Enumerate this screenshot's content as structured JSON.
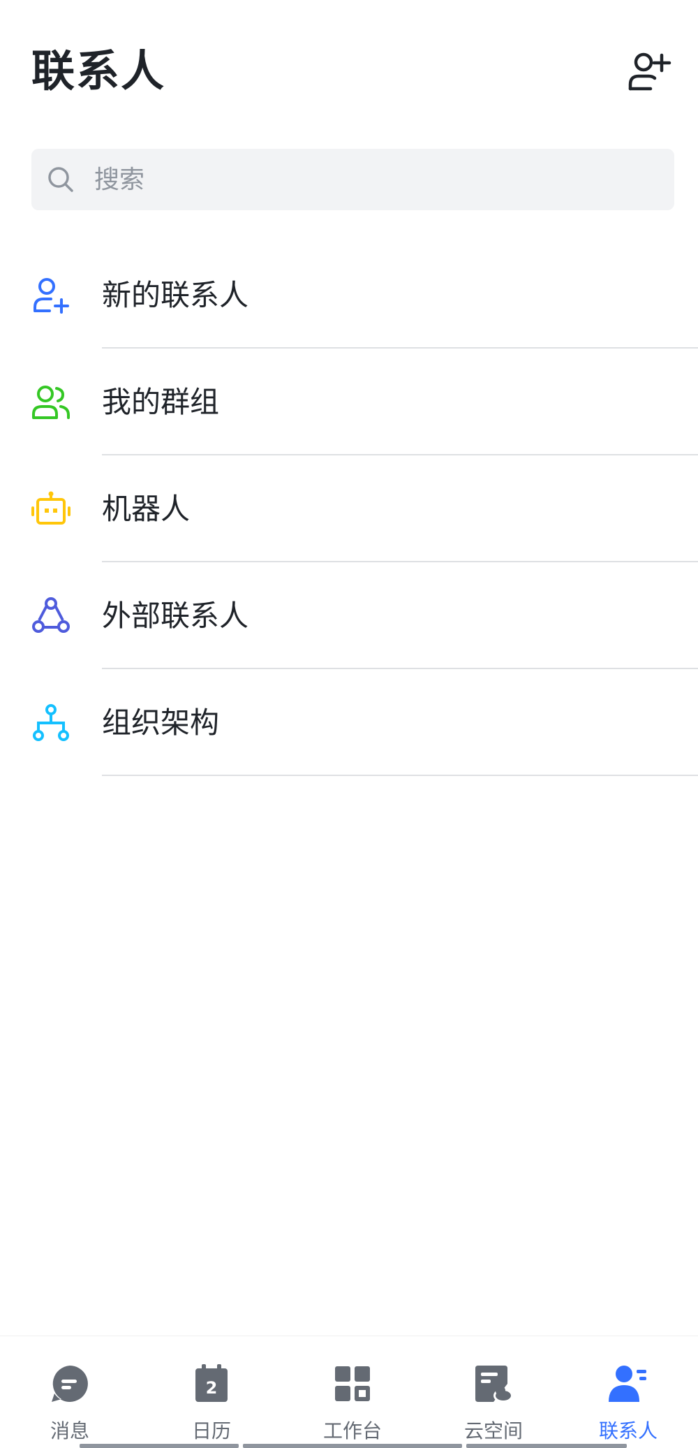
{
  "header": {
    "title": "联系人",
    "add_contact_icon": "add-contact-icon"
  },
  "search": {
    "placeholder": "搜索",
    "value": "",
    "icon": "search-icon"
  },
  "menu": {
    "items": [
      {
        "label": "新的联系人",
        "icon": "new-contact-icon",
        "color": "#3370ff"
      },
      {
        "label": "我的群组",
        "icon": "group-icon",
        "color": "#34c724"
      },
      {
        "label": "机器人",
        "icon": "robot-icon",
        "color": "#ffc60a"
      },
      {
        "label": "外部联系人",
        "icon": "external-contact-icon",
        "color": "#4e5bdc"
      },
      {
        "label": "组织架构",
        "icon": "org-structure-icon",
        "color": "#14c0ff"
      }
    ]
  },
  "tabbar": {
    "tabs": [
      {
        "label": "消息",
        "icon": "message-icon",
        "active": false
      },
      {
        "label": "日历",
        "icon": "calendar-icon",
        "badge": "2",
        "active": false
      },
      {
        "label": "工作台",
        "icon": "workspace-icon",
        "active": false
      },
      {
        "label": "云空间",
        "icon": "cloud-space-icon",
        "active": false
      },
      {
        "label": "联系人",
        "icon": "contacts-icon",
        "active": true
      }
    ]
  },
  "colors": {
    "accent": "#3370ff",
    "inactive": "#646a73",
    "divider": "#dee0e3",
    "search_bg": "#f2f3f5"
  }
}
